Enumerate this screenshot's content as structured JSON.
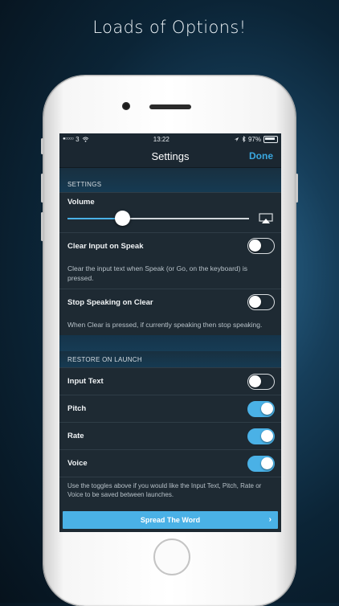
{
  "headline": "Loads of Options!",
  "status_bar": {
    "carrier": "3",
    "time": "13:22",
    "battery": "97%"
  },
  "nav": {
    "title": "Settings",
    "done_label": "Done"
  },
  "settings_section": {
    "header": "SETTINGS",
    "volume_label": "Volume",
    "volume_level": 0.3,
    "clear_input": {
      "label": "Clear Input on Speak",
      "description": "Clear the input text when Speak (or Go, on the keyboard) is pressed.",
      "on": false
    },
    "stop_speaking": {
      "label": "Stop Speaking on Clear",
      "description": "When Clear is pressed, if currently speaking then stop speaking.",
      "on": false
    }
  },
  "restore_section": {
    "header": "RESTORE ON LAUNCH",
    "items": [
      {
        "label": "Input Text",
        "on": false
      },
      {
        "label": "Pitch",
        "on": true
      },
      {
        "label": "Rate",
        "on": true
      },
      {
        "label": "Voice",
        "on": true
      }
    ],
    "footer": "Use the toggles above if you would like the Input Text, Pitch, Rate or Voice to be saved between launches."
  },
  "spread_button": "Spread The Word",
  "colors": {
    "accent": "#4ab1e6",
    "done": "#3aa8e0",
    "cell_background": "#1e2a33"
  }
}
